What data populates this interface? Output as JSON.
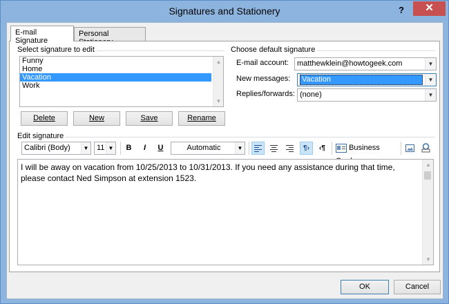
{
  "window": {
    "title": "Signatures and Stationery",
    "help": "?",
    "close": "✕"
  },
  "tabs": [
    {
      "label": "E-mail Signature",
      "active": true
    },
    {
      "label": "Personal Stationery",
      "active": false
    }
  ],
  "select_signature": {
    "label": "Select signature to edit",
    "items": [
      "Funny",
      "Home",
      "Vacation",
      "Work"
    ],
    "selected_index": 2
  },
  "signature_buttons": {
    "delete": "Delete",
    "new": "New",
    "save": "Save",
    "rename": "Rename"
  },
  "default_signature": {
    "label": "Choose default signature",
    "email_account_label": "E-mail account:",
    "email_account_value": "matthewklein@howtogeek.com",
    "new_messages_label": "New messages:",
    "new_messages_value": "Vacation",
    "replies_label": "Replies/forwards:",
    "replies_value": "(none)"
  },
  "edit_signature": {
    "label": "Edit signature",
    "font": "Calibri (Body)",
    "size": "11",
    "bold": "B",
    "italic": "I",
    "underline": "U",
    "color": "Automatic",
    "business_card": "Business Card",
    "text": "I will be away  on vacation from 10/25/2013 to 10/31/2013. If you need any assistance during that time, please contact Ned Simpson at extension 1523."
  },
  "footer": {
    "ok": "OK",
    "cancel": "Cancel"
  },
  "colors": {
    "title_bar": "#8db4de",
    "close_button": "#c75050",
    "selection": "#3399ff"
  }
}
